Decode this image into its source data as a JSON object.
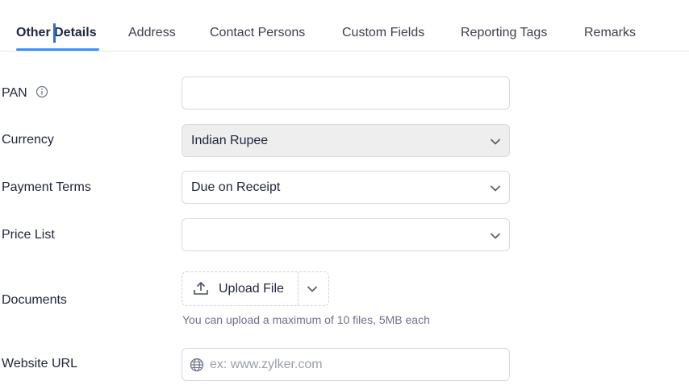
{
  "tabs": [
    {
      "label": "Other Details",
      "active": true
    },
    {
      "label": "Address"
    },
    {
      "label": "Contact Persons"
    },
    {
      "label": "Custom Fields"
    },
    {
      "label": "Reporting Tags"
    },
    {
      "label": "Remarks"
    }
  ],
  "form": {
    "pan": {
      "label": "PAN",
      "value": "",
      "icon": "info-icon"
    },
    "currency": {
      "label": "Currency",
      "value": "Indian Rupee"
    },
    "payment_terms": {
      "label": "Payment Terms",
      "value": "Due on Receipt"
    },
    "price_list": {
      "label": "Price List",
      "value": ""
    },
    "documents": {
      "label": "Documents",
      "upload_label": "Upload File",
      "hint": "You can upload a maximum of 10 files, 5MB each"
    },
    "website": {
      "label": "Website URL",
      "placeholder": "ex: www.zylker.com",
      "value": ""
    }
  },
  "colors": {
    "accent": "#408dfb",
    "text": "#21263c",
    "border": "#d7d9de",
    "disabled_bg": "#eeeeee"
  }
}
